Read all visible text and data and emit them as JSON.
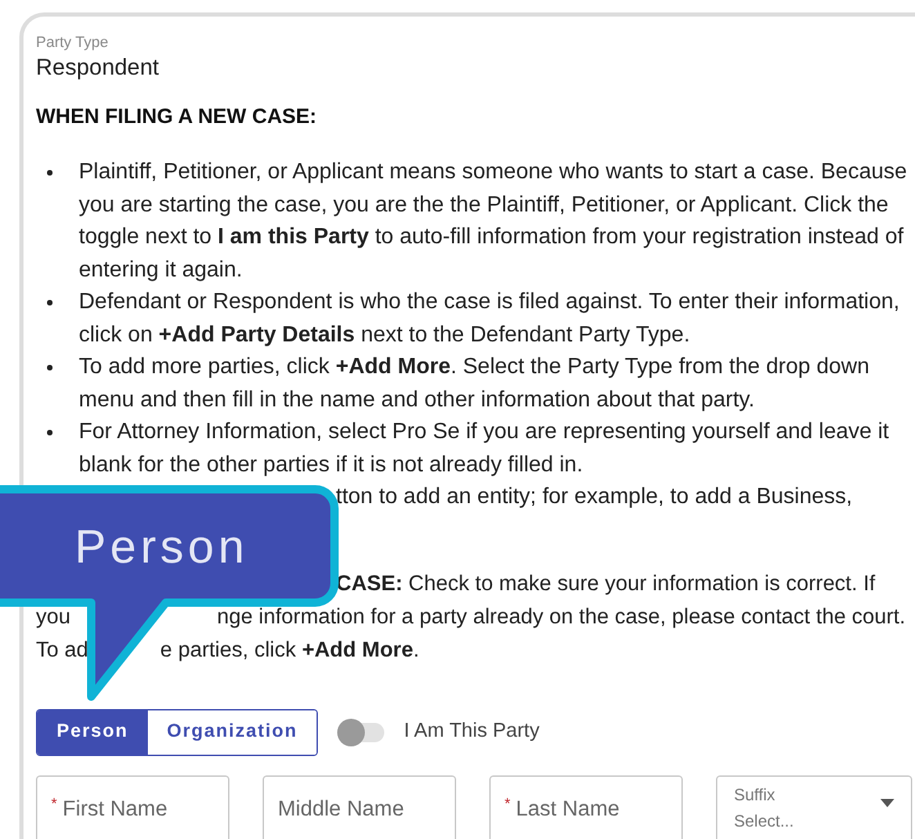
{
  "party_type": {
    "label": "Party Type",
    "value": "Respondent"
  },
  "heading": "WHEN FILING A NEW CASE:",
  "bullets": [
    {
      "lines": [
        "Plaintiff, Petitioner, or Applicant means someone who wants to start a case. Because",
        "you are starting the case, you are the the Plaintiff, Petitioner, or Applicant. Click the",
        "toggle next to **I am this Party** to auto-fill information from your registration instead of",
        "entering it again."
      ]
    },
    {
      "lines": [
        "Defendant or Respondent is who the case is filed against. To enter their information,",
        "click on **+Add Party Details** next to the Defendant Party Type."
      ]
    },
    {
      "lines": [
        "To add more parties, click **+Add More**. Select the Party Type from the drop down",
        "menu and then fill in the name and other information about that party."
      ]
    },
    {
      "lines": [
        "For Attorney Information, select Pro Se if you are representing yourself and leave it",
        "blank for the other parties if it is not already filled in."
      ]
    }
  ],
  "partial_bullet": "tton to add an entity; for example, to add a Business,",
  "existing_case": {
    "line_1": "**CASE:** Check to make sure your information is correct. If",
    "line_2_start": "you",
    "line_2_end": "nge information for a party already on the case, please contact the court.",
    "line_3_start": "To ad",
    "line_3_end": "e parties, click **+Add More**."
  },
  "callout": {
    "text": "Person"
  },
  "party_kind_tabs": [
    {
      "label": "Person",
      "selected": true
    },
    {
      "label": "Organization",
      "selected": false
    }
  ],
  "self_toggle": {
    "label": "I Am This Party",
    "on": false
  },
  "fields": [
    {
      "kind": "text",
      "label": "First Name",
      "required_mark": "*"
    },
    {
      "kind": "text",
      "label": "Middle Name"
    },
    {
      "kind": "text",
      "label": "Last Name",
      "required_mark": "*"
    },
    {
      "kind": "select",
      "label": "Suffix",
      "placeholder": "Select..."
    }
  ]
}
